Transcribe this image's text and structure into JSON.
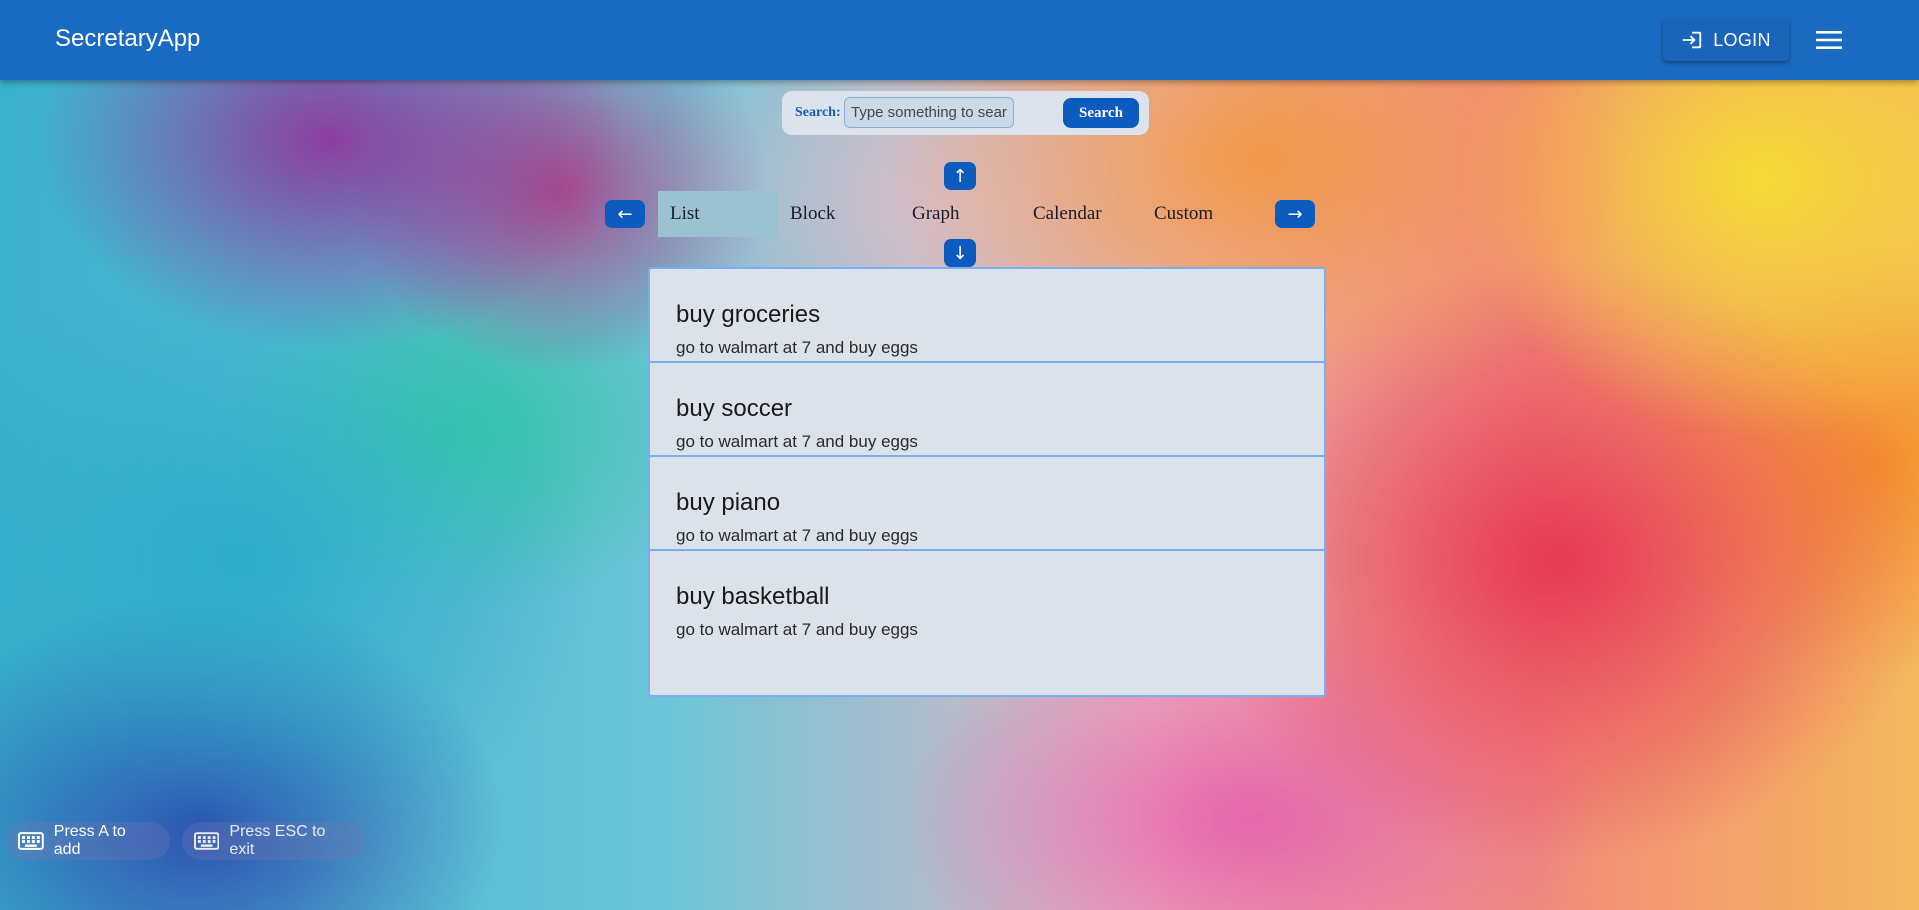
{
  "app": {
    "title": "SecretaryApp",
    "login_label": "LOGIN"
  },
  "search": {
    "label": "Search:",
    "placeholder": "Type something to search...",
    "button_label": "Search"
  },
  "nav": {
    "up": "↑",
    "down": "↓",
    "left": "←",
    "right": "→"
  },
  "views": {
    "active": "List",
    "tabs": [
      "List",
      "Block",
      "Graph",
      "Calendar",
      "Custom"
    ]
  },
  "tasks": [
    {
      "title": "buy groceries",
      "description": "go to walmart at 7 and buy eggs"
    },
    {
      "title": "buy soccer",
      "description": "go to walmart at 7 and buy eggs"
    },
    {
      "title": "buy piano",
      "description": "go to walmart at 7 and buy eggs"
    },
    {
      "title": "buy basketball",
      "description": "go to walmart at 7 and buy eggs"
    }
  ],
  "hints": {
    "add": "Press A to add",
    "exit": "Press ESC to exit"
  },
  "icons": {
    "login": "login-icon",
    "menu": "hamburger-menu-icon",
    "keyboard": "keyboard-icon"
  },
  "colors": {
    "appbar": "#1a6ac2",
    "accent": "#0c5bbf",
    "card_bg": "#dbe2ea",
    "card_border": "#7aaef2",
    "active_tab": "#9ac2d0"
  }
}
